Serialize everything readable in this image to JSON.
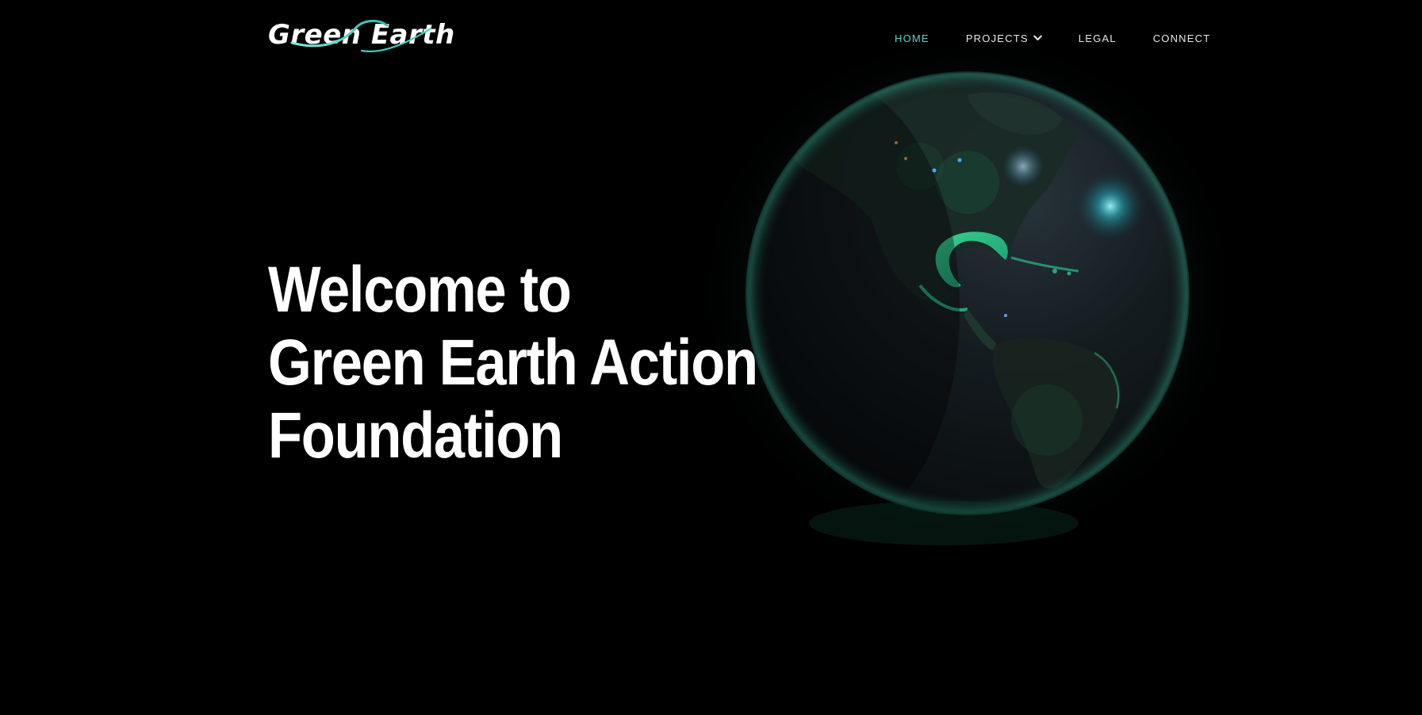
{
  "brand": {
    "logo_text": "Green Earth",
    "accent_color": "#5fd4c9",
    "swoosh_color": "#3fd0b8"
  },
  "nav": {
    "items": [
      {
        "label": "HOME",
        "active": true
      },
      {
        "label": "PROJECTS",
        "has_dropdown": true,
        "icon": "chevron-down-icon"
      },
      {
        "label": "LEGAL"
      },
      {
        "label": "CONNECT"
      }
    ]
  },
  "hero": {
    "title_lines": [
      "Welcome to",
      "Green Earth Action",
      "Foundation"
    ]
  },
  "colors": {
    "background": "#000000",
    "text": "#ffffff",
    "globe_glow": "#2fd59a"
  }
}
